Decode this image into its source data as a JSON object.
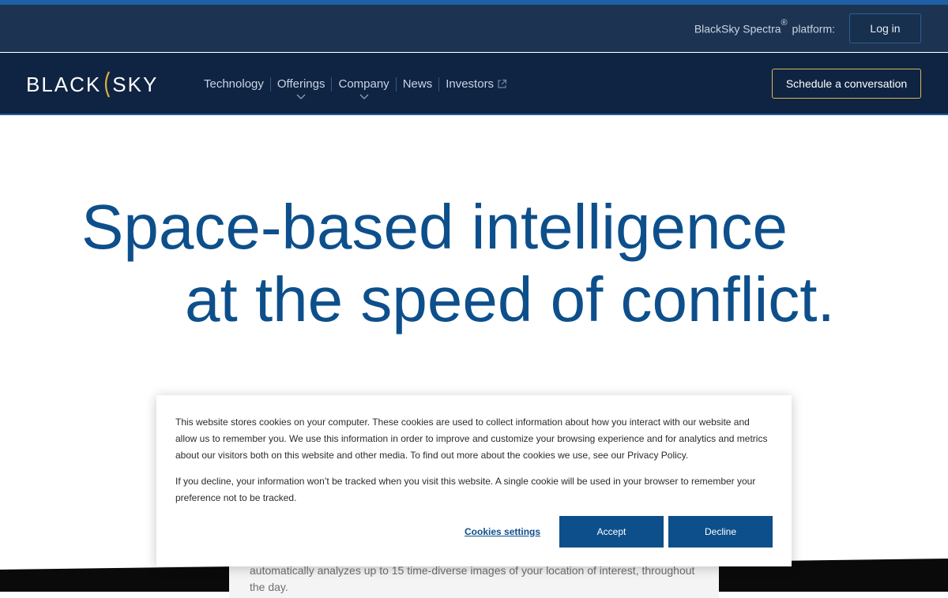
{
  "utility_bar": {
    "platform_label": "BlackSky Spectra",
    "registered_mark": "®",
    "platform_suffix": " platform:",
    "login_label": "Log in"
  },
  "nav": {
    "logo_left": "BLACK",
    "logo_right": "SKY",
    "items": [
      {
        "label": "Technology",
        "dropdown": false
      },
      {
        "label": "Offerings",
        "dropdown": true
      },
      {
        "label": "Company",
        "dropdown": true
      },
      {
        "label": "News",
        "dropdown": false
      },
      {
        "label": "Investors",
        "dropdown": false,
        "external": true
      }
    ],
    "cta_label": "Schedule a conversation"
  },
  "hero": {
    "line1": "Space-based intelligence",
    "line2": "at the speed of conflict."
  },
  "content": {
    "text": "automatically analyzes up to 15 time-diverse images of your location of interest, throughout the day."
  },
  "cookie_banner": {
    "paragraph1": "This website stores cookies on your computer. These cookies are used to collect information about how you interact with our website and allow us to remember you. We use this information in order to improve and customize your browsing experience and for analytics and metrics about our visitors both on this website and other media. To find out more about the cookies we use, see our Privacy Policy.",
    "paragraph2": "If you decline, your information won’t be tracked when you visit this website. A single cookie will be used in your browser to remember your preference not to be tracked.",
    "settings_label": "Cookies settings",
    "accept_label": "Accept",
    "decline_label": "Decline"
  },
  "colors": {
    "brand_navy": "#0f2442",
    "accent_blue": "#0d4f8b",
    "cta_border_gold": "#d9b85a"
  }
}
